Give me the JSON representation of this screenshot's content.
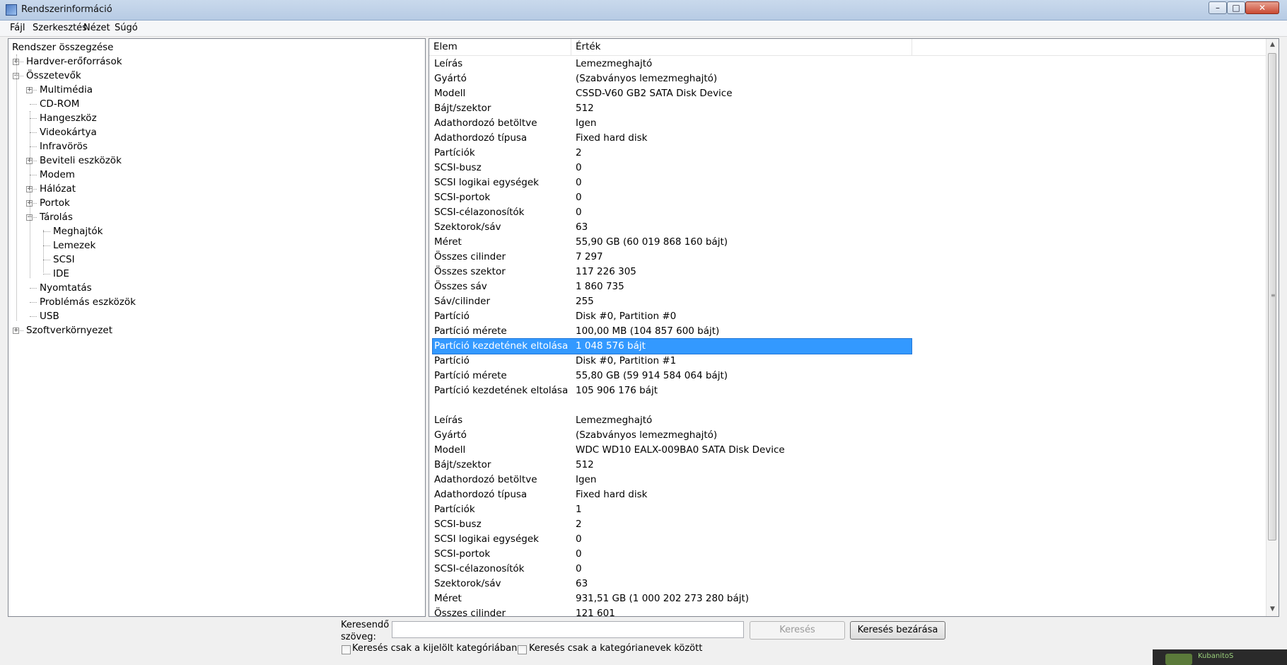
{
  "window": {
    "title": "Rendszerinformáció"
  },
  "titlebar_buttons": {
    "minimize": "–",
    "maximize": "□",
    "close": "✕"
  },
  "menu": [
    "Fájl",
    "Szerkesztés",
    "Nézet",
    "Súgó"
  ],
  "tree": [
    {
      "label": "Rendszer összegzése",
      "level": 0,
      "expander": ""
    },
    {
      "label": "Hardver-erőforrások",
      "level": 1,
      "expander": "+"
    },
    {
      "label": "Összetevők",
      "level": 1,
      "expander": "−"
    },
    {
      "label": "Multimédia",
      "level": 2,
      "expander": "+"
    },
    {
      "label": "CD-ROM",
      "level": 2,
      "expander": ""
    },
    {
      "label": "Hangeszköz",
      "level": 2,
      "expander": ""
    },
    {
      "label": "Videokártya",
      "level": 2,
      "expander": ""
    },
    {
      "label": "Infravörös",
      "level": 2,
      "expander": ""
    },
    {
      "label": "Beviteli eszközök",
      "level": 2,
      "expander": "+"
    },
    {
      "label": "Modem",
      "level": 2,
      "expander": ""
    },
    {
      "label": "Hálózat",
      "level": 2,
      "expander": "+"
    },
    {
      "label": "Portok",
      "level": 2,
      "expander": "+"
    },
    {
      "label": "Tárolás",
      "level": 2,
      "expander": "−"
    },
    {
      "label": "Meghajtók",
      "level": 3,
      "expander": ""
    },
    {
      "label": "Lemezek",
      "level": 3,
      "expander": ""
    },
    {
      "label": "SCSI",
      "level": 3,
      "expander": ""
    },
    {
      "label": "IDE",
      "level": 3,
      "expander": ""
    },
    {
      "label": "Nyomtatás",
      "level": 2,
      "expander": ""
    },
    {
      "label": "Problémás eszközök",
      "level": 2,
      "expander": ""
    },
    {
      "label": "USB",
      "level": 2,
      "expander": ""
    },
    {
      "label": "Szoftverkörnyezet",
      "level": 1,
      "expander": "+"
    }
  ],
  "columns": [
    "Elem",
    "Érték"
  ],
  "selected_row": 19,
  "rows": [
    [
      "Leírás",
      "Lemezmeghajtó"
    ],
    [
      "Gyártó",
      "(Szabványos lemezmeghajtó)"
    ],
    [
      "Modell",
      "CSSD-V60 GB2 SATA Disk Device"
    ],
    [
      "Bájt/szektor",
      "512"
    ],
    [
      "Adathordozó betöltve",
      "Igen"
    ],
    [
      "Adathordozó típusa",
      "Fixed hard disk"
    ],
    [
      "Partíciók",
      "2"
    ],
    [
      "SCSI-busz",
      "0"
    ],
    [
      "SCSI logikai egységek",
      "0"
    ],
    [
      "SCSI-portok",
      "0"
    ],
    [
      "SCSI-célazonosítók",
      "0"
    ],
    [
      "Szektorok/sáv",
      "63"
    ],
    [
      "Méret",
      "55,90 GB (60 019 868 160 bájt)"
    ],
    [
      "Összes cilinder",
      "7 297"
    ],
    [
      "Összes szektor",
      "117 226 305"
    ],
    [
      "Összes sáv",
      "1 860 735"
    ],
    [
      "Sáv/cilinder",
      "255"
    ],
    [
      "Partíció",
      "Disk #0, Partition #0"
    ],
    [
      "Partíció mérete",
      "100,00 MB (104 857 600 bájt)"
    ],
    [
      "Partíció kezdetének eltolása",
      "1 048 576 bájt"
    ],
    [
      "Partíció",
      "Disk #0, Partition #1"
    ],
    [
      "Partíció mérete",
      "55,80 GB (59 914 584 064 bájt)"
    ],
    [
      "Partíció kezdetének eltolása",
      "105 906 176 bájt"
    ],
    [
      "",
      ""
    ],
    [
      "Leírás",
      "Lemezmeghajtó"
    ],
    [
      "Gyártó",
      "(Szabványos lemezmeghajtó)"
    ],
    [
      "Modell",
      "WDC WD10 EALX-009BA0 SATA Disk Device"
    ],
    [
      "Bájt/szektor",
      "512"
    ],
    [
      "Adathordozó betöltve",
      "Igen"
    ],
    [
      "Adathordozó típusa",
      "Fixed hard disk"
    ],
    [
      "Partíciók",
      "1"
    ],
    [
      "SCSI-busz",
      "2"
    ],
    [
      "SCSI logikai egységek",
      "0"
    ],
    [
      "SCSI-portok",
      "0"
    ],
    [
      "SCSI-célazonosítók",
      "0"
    ],
    [
      "Szektorok/sáv",
      "63"
    ],
    [
      "Méret",
      "931,51 GB (1 000 202 273 280 bájt)"
    ],
    [
      "Összes cilinder",
      "121 601"
    ]
  ],
  "search": {
    "label": "Keresendő szöveg:",
    "value": "",
    "search_button": "Keresés",
    "close_button": "Keresés bezárása",
    "option1": "Keresés csak a kijelölt kategóriában",
    "option2": "Keresés csak a kategórianevek között"
  },
  "taskbar_fragment": {
    "label": "KubanitoS"
  }
}
